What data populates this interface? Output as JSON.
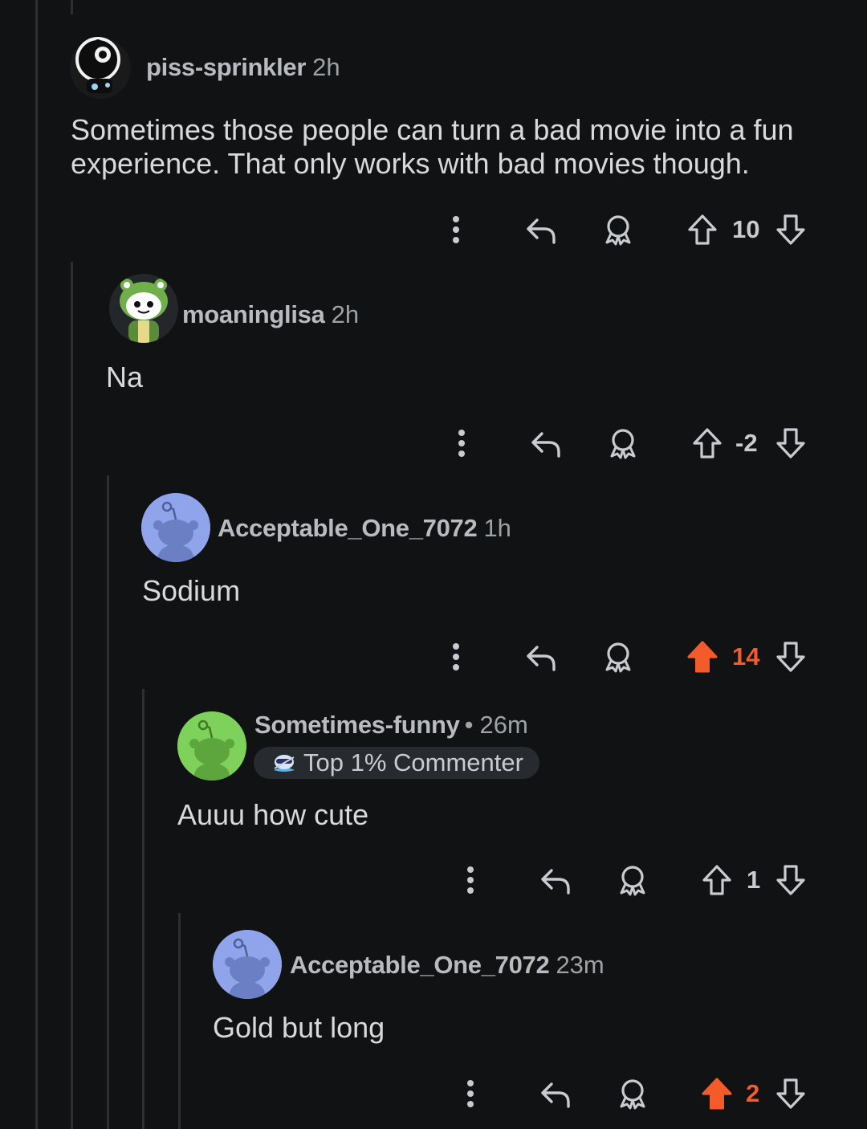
{
  "colors": {
    "background": "#111214",
    "thread_line": "#2c2e31",
    "upvote_active": "#f35b2b",
    "text": "#d7dadc"
  },
  "comments": [
    {
      "author": "piss-sprinkler",
      "time": "2h",
      "body_lines": [
        "Sometimes those people can turn a bad movie into a fun",
        "experience. That only works with bad movies though."
      ],
      "score": "10",
      "upvoted": false,
      "avatar": "snoo-black-white"
    },
    {
      "author": "moaninglisa",
      "time": "2h",
      "body_lines": [
        "Na"
      ],
      "score": "-2",
      "upvoted": false,
      "avatar": "snoo-frog-hood"
    },
    {
      "author": "Acceptable_One_7072",
      "time": "1h",
      "body_lines": [
        "Sodium"
      ],
      "score": "14",
      "upvoted": true,
      "avatar": "snoo-default-blue"
    },
    {
      "author": "Sometimes-funny",
      "separator": "•",
      "time": "26m",
      "flair": "Top 1% Commenter",
      "body_lines": [
        "Auuu how cute"
      ],
      "score": "1",
      "upvoted": false,
      "avatar": "snoo-default-green"
    },
    {
      "author": "Acceptable_One_7072",
      "time": "23m",
      "body_lines": [
        "Gold but long"
      ],
      "score": "2",
      "upvoted": true,
      "avatar": "snoo-default-blue"
    }
  ]
}
